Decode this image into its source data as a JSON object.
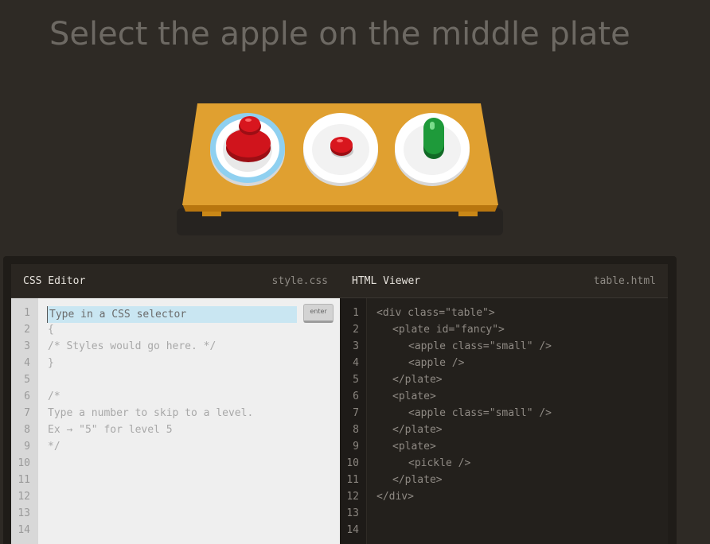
{
  "instruction": "Select the apple on the middle plate",
  "css_editor": {
    "title": "CSS Editor",
    "file": "style.css",
    "input_placeholder": "Type in a CSS selector",
    "enter_label": "enter",
    "line_numbers": [
      "1",
      "2",
      "3",
      "4",
      "5",
      "6",
      "7",
      "8",
      "9",
      "10",
      "11",
      "12",
      "13",
      "14"
    ],
    "lines": [
      "",
      "{",
      "/* Styles would go here. */",
      "}",
      "",
      "/*",
      "Type a number to skip to a level.",
      "Ex → \"5\" for level 5",
      "*/",
      "",
      "",
      "",
      "",
      ""
    ]
  },
  "html_viewer": {
    "title": "HTML Viewer",
    "file": "table.html",
    "line_numbers": [
      "1",
      "2",
      "3",
      "4",
      "5",
      "6",
      "7",
      "8",
      "9",
      "10",
      "11",
      "12",
      "13",
      "14"
    ],
    "lines": [
      {
        "indent": 0,
        "text": "<div class=\"table\">"
      },
      {
        "indent": 1,
        "text": "<plate id=\"fancy\">"
      },
      {
        "indent": 2,
        "text": "<apple class=\"small\" />"
      },
      {
        "indent": 2,
        "text": "<apple />"
      },
      {
        "indent": 1,
        "text": "</plate>"
      },
      {
        "indent": 1,
        "text": "<plate>"
      },
      {
        "indent": 2,
        "text": "<apple class=\"small\" />"
      },
      {
        "indent": 1,
        "text": "</plate>"
      },
      {
        "indent": 1,
        "text": "<plate>"
      },
      {
        "indent": 2,
        "text": "<pickle />"
      },
      {
        "indent": 1,
        "text": "</plate>"
      },
      {
        "indent": 0,
        "text": "</div>"
      },
      {
        "indent": 0,
        "text": ""
      },
      {
        "indent": 0,
        "text": ""
      }
    ]
  },
  "colors": {
    "background": "#2e2a25",
    "table_top": "#e0a030",
    "apple_red": "#d0141c",
    "pickle_green": "#1e9a3a",
    "fancy_plate_ring": "#8fd0f0",
    "input_highlight": "#c9e6f2"
  }
}
